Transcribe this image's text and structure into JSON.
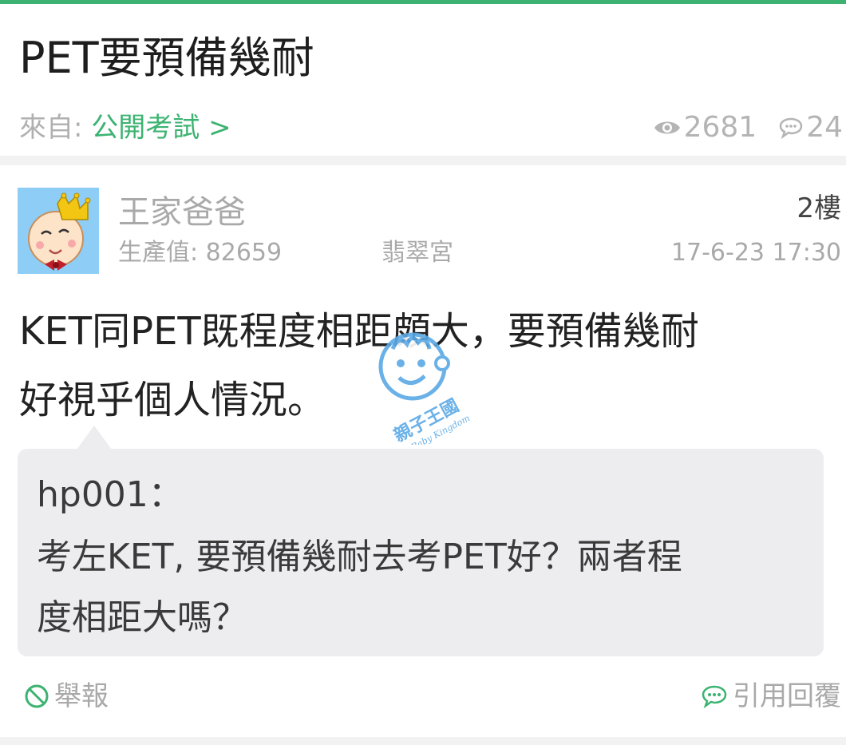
{
  "thread": {
    "title": "PET要預備幾耐",
    "from_label": "來自: ",
    "from_forum": "公開考試 >",
    "views": "2681",
    "replies": "24"
  },
  "post": {
    "author": "王家爸爸",
    "floor": "2樓",
    "points": "生產值: 82659",
    "group": "翡翠宮",
    "time": "17-6-23 17:30",
    "content_line1": "KET同PET既程度相距頗大，要預備幾耐",
    "content_line2": "好視乎個人情況。",
    "watermark_text": "親子王國",
    "watermark_subtext": "Baby Kingdom",
    "quote": {
      "author": "hp001：",
      "line1": "考左KET, 要預備幾耐去考PET好？兩者程",
      "line2": "度相距大嗎？"
    },
    "report_label": "舉報",
    "reply_label": "引用回覆"
  },
  "icons": {
    "views": "eye-icon",
    "replies": "comment-icon",
    "report": "ban-icon",
    "reply": "speech-bubble-icon"
  },
  "colors": {
    "accent": "#3cb371",
    "muted": "#a9a9a9",
    "quote_bg": "#ededf0"
  }
}
